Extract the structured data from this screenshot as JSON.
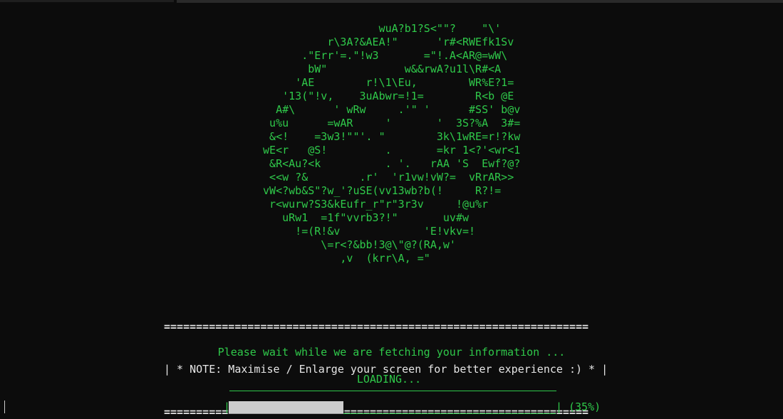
{
  "terminal": {
    "ascii_art": "                   wuA?b1?S<\"\"?    \"\\'\n           r\\3A?&AEA!\"      'r#<RWEfk1Sv\n       .\"Err'=.\"!w3       =\"!.A<AR@=wW\\\n        bW\"            w&&rwA?u1l\\R#<A\n      'AE        r!\\1\\Eu,        WR%E?1=\n    '13(\"!v,    3uAbwr=!1=        R<b @E\n   A#\\      ' wRw     .'\" '      #SS' b@v\n  u%u      =wAR     '       '  3S?%A  3#=\n  &<!    =3w3!\"\"'. \"        3k\\1wRE=r!?kw\n wE<r   @S!         .       =kr 1<?'<wr<1\n  &R<Au?<k          . '.   rAA 'S  Ewf?@?\n  <<w ?&        .r'  'r1vw!vW?=  vRrAR>>\n vW<?wb&S\"?w_'?uSE(vv13wb?b(!     R?!=\n  r<wurw?S3&kEufr_r\"r\"3r3v     !@u%r\n    uRw1  =1f\"vvrb3?!\"       uv#w\n      !=(R!&v             'E!vkv=!\n          \\=r<?&bb!3@\\\"@?(RA,w'\n             ,v  (krr\\A, =\"",
    "note_rule": "==================================================================",
    "note_text": "| * NOTE: Maximise / Enlarge your screen for better experience :) * |",
    "wait_message": "Please wait while we are fetching your information ...",
    "loading_label": "LOADING...",
    "progress": {
      "left_bracket": "|",
      "right_bracket": "|",
      "percent_label": "(35%)",
      "fraction": 0.35,
      "fill_color": "#cccccc",
      "track_color": "#2fc94a"
    },
    "colors": {
      "background": "#0c0c0c",
      "accent_green": "#2fc94a",
      "note_text": "#e6e6e6"
    }
  }
}
